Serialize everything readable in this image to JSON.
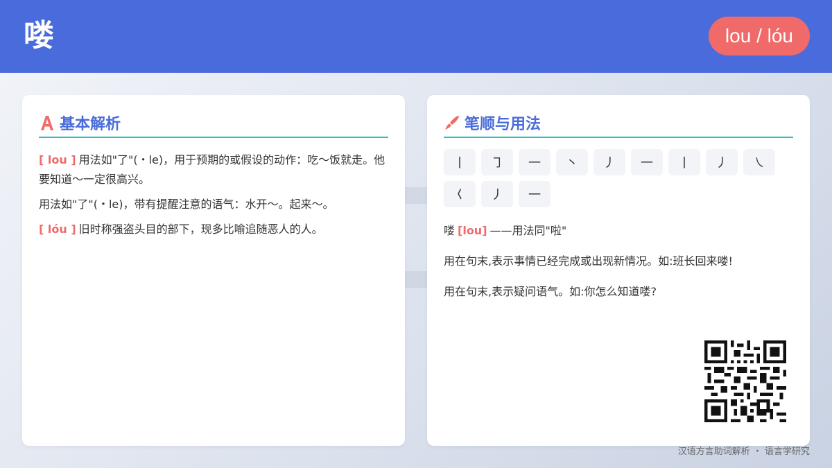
{
  "header": {
    "character": "喽",
    "pinyin": "lou / lóu"
  },
  "basic": {
    "title": "基本解析",
    "icon": "font-A-icon",
    "entries": [
      {
        "tag": "[ lou ]",
        "text": "用法如\"了\"(・le)，用于预期的或假设的动作：吃～饭就走。他要知道～一定很高兴。"
      },
      {
        "tag": "",
        "text": "用法如\"了\"(・le)，带有提醒注意的语气：水开～。起来～。"
      },
      {
        "tag": "[ lóu ]",
        "text": "旧时称强盗头目的部下，现多比喻追随恶人的人。"
      }
    ]
  },
  "usage": {
    "title": "笔顺与用法",
    "icon": "pen-icon",
    "strokes": [
      "丨",
      "㇆",
      "一",
      "丶",
      "丿",
      "一",
      "丨",
      "丿",
      "㇏",
      "𡿨",
      "丿",
      "一"
    ],
    "line1_char": "喽",
    "line1_pinyin": "[lou]",
    "line1_text": "——用法同\"啦\"",
    "line2": "用在句末,表示事情已经完成或出现新情况。如:班长回来喽!",
    "line3": "用在句末,表示疑问语气。如:你怎么知道喽?"
  },
  "qr": {
    "icon": "qr-code-icon"
  },
  "footer": "汉语方言助词解析 ・ 语言学研究",
  "colors": {
    "header": "#4a6bdb",
    "accent_red": "#f06a6a",
    "accent_teal": "#2fc0c4"
  }
}
